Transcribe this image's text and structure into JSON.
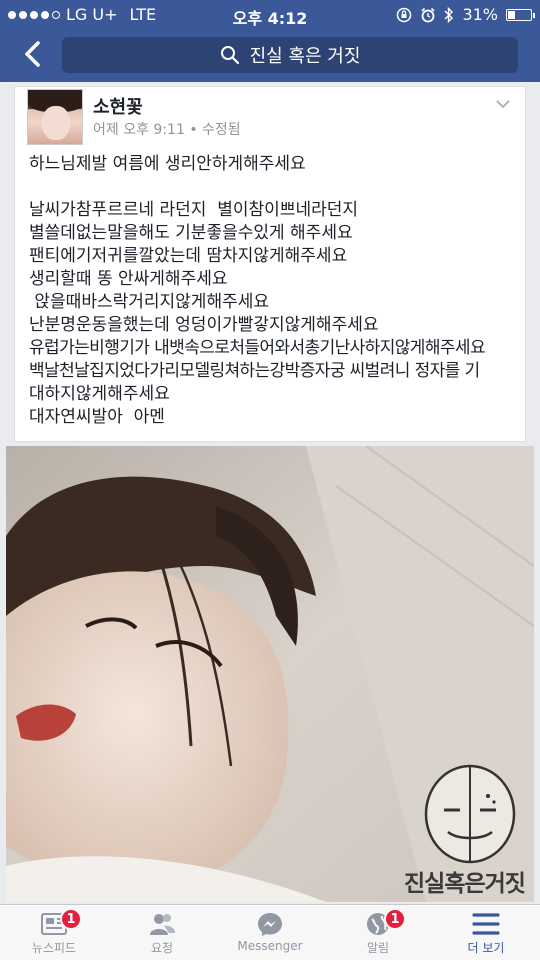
{
  "status_bar": {
    "carrier": "LG U+",
    "network": "LTE",
    "time": "오후 4:12",
    "battery": "31%",
    "battery_level": 0.31,
    "icons": [
      "lock-rotation-icon",
      "alarm-icon",
      "bluetooth-icon"
    ]
  },
  "nav": {
    "search_text": "진실 혹은 거짓",
    "back_icon": "chevron-left-icon"
  },
  "post": {
    "author": "소현꽃",
    "time": "어제 오후 9:11",
    "edited": "수정됨",
    "separator": "•",
    "lines": [
      "하느님제발 여름에 생리안하게해주세요",
      "",
      "날씨가참푸르르네 라던지  별이참이쁘네라던지",
      "별쓸데없는말을해도 기분좋을수있게 해주세요",
      "팬티에기저귀를깔았는데 땀차지않게해주세요",
      "생리할때 똥 안싸게해주세요",
      " 앉을때바스락거리지않게해주세요",
      "난분명운동을했는데 엉덩이가빨갛지않게해주세요",
      "유럽가는비행기가 내뱃속으로처들어와서총기난사하지않게해주세요",
      "백날천날집지었다가리모델링쳐하는강박증자궁 씨벌려니 정자를 기",
      "대하지않게해주세요",
      "대자연씨발아  아멘"
    ],
    "watermark": "진실혹은거짓"
  },
  "tabbar": {
    "tabs": [
      {
        "label": "뉴스피드",
        "icon": "news-feed-icon",
        "badge": "1"
      },
      {
        "label": "요청",
        "icon": "friend-requests-icon",
        "badge": ""
      },
      {
        "label": "Messenger",
        "icon": "messenger-icon",
        "badge": ""
      },
      {
        "label": "알림",
        "icon": "globe-notifications-icon",
        "badge": "1"
      },
      {
        "label": "더 보기",
        "icon": "menu-icon",
        "badge": ""
      }
    ],
    "active_index": 4
  },
  "colors": {
    "brand": "#3b5998",
    "badge": "#e41e3f"
  }
}
